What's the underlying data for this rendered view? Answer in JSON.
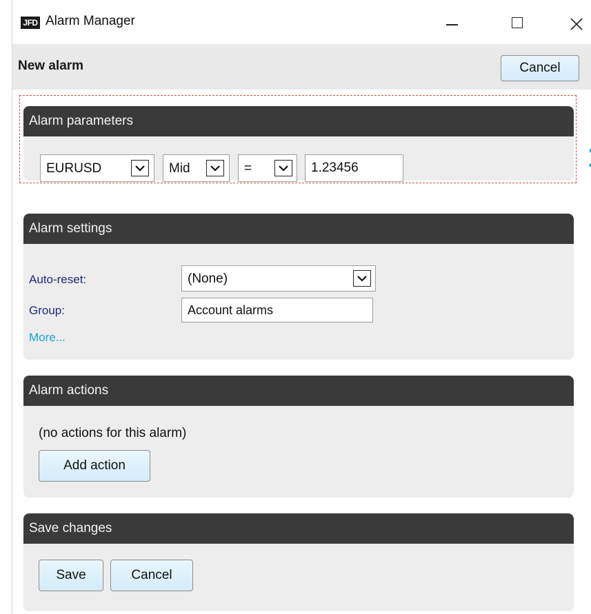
{
  "window": {
    "logo_text": "JFD",
    "title": "Alarm Manager"
  },
  "header": {
    "title": "New alarm",
    "cancel_label": "Cancel"
  },
  "alarm_parameters": {
    "heading": "Alarm parameters",
    "symbol": "EURUSD",
    "price_type": "Mid",
    "operator": "=",
    "value": "1.23456"
  },
  "alarm_settings": {
    "heading": "Alarm settings",
    "auto_reset_label": "Auto-reset:",
    "auto_reset_value": "(None)",
    "group_label": "Group:",
    "group_value": "Account alarms",
    "more_link": "More..."
  },
  "alarm_actions": {
    "heading": "Alarm actions",
    "empty_text": "(no actions for this alarm)",
    "add_action_label": "Add action"
  },
  "save_changes": {
    "heading": "Save changes",
    "save_label": "Save",
    "cancel_label": "Cancel"
  },
  "annotation": {
    "marker": "1"
  }
}
